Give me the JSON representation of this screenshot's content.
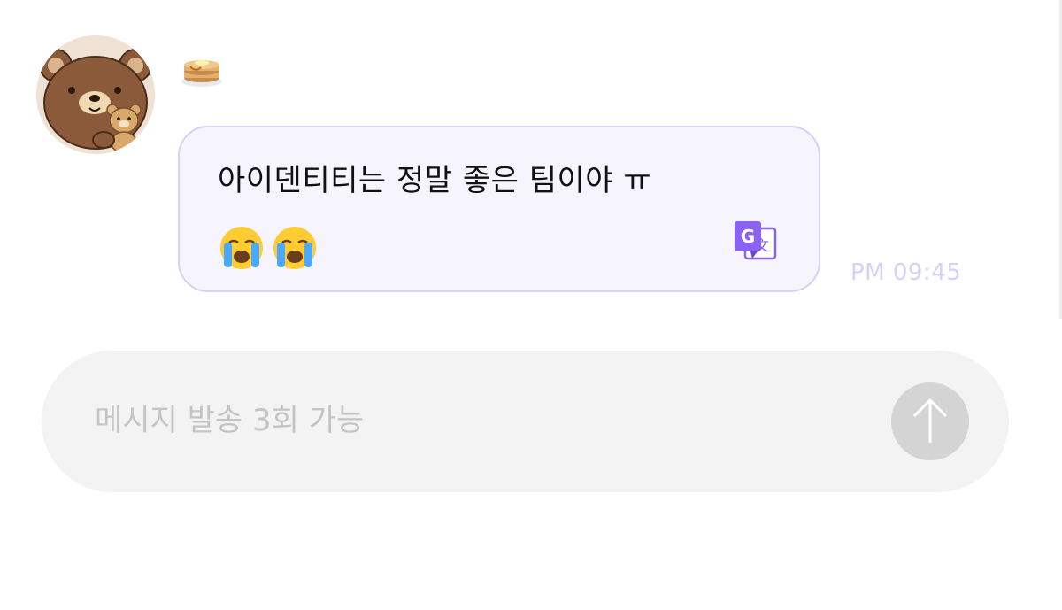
{
  "message": {
    "sender_icon": "pancake-emoji-icon",
    "avatar_icon": "bear-avatar-icon",
    "text_line1": "아이덴티티는 정말 좋은 팀이야 ㅠ",
    "emojis": [
      "crying-face-emoji",
      "crying-face-emoji"
    ],
    "translate_icon": "google-translate-icon",
    "timestamp": "PM 09:45"
  },
  "composer": {
    "placeholder": "메시지 발송 3회 가능",
    "send_icon": "arrow-up-icon"
  },
  "colors": {
    "bubble_bg": "#f6f4fd",
    "bubble_border": "#d9d0f5",
    "accent_purple": "#7e57ff",
    "timestamp": "#d8cff7",
    "input_bg": "#f3f3f3",
    "send_button": "#d4d4d4"
  }
}
